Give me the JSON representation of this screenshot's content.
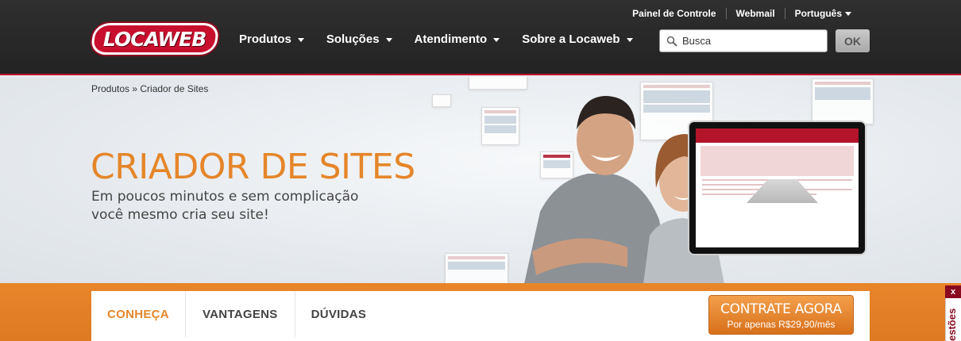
{
  "header": {
    "logo_text": "LOCAWEB",
    "util_links": [
      "Painel de Controle",
      "Webmail",
      "Português"
    ],
    "nav": [
      "Produtos",
      "Soluções",
      "Atendimento",
      "Sobre a Locaweb"
    ],
    "search": {
      "placeholder": "Busca",
      "button": "OK"
    }
  },
  "hero": {
    "breadcrumb": "Produtos » Criador de Sites",
    "title": "CRIADOR DE SITES",
    "subtitle_line1": "Em poucos minutos e sem complicação",
    "subtitle_line2": "você mesmo cria seu site!"
  },
  "tabs": {
    "items": [
      "CONHEÇA",
      "VANTAGENS",
      "DÚVIDAS"
    ],
    "active": "CONHEÇA"
  },
  "cta": {
    "title": "CONTRATE AGORA",
    "subtitle": "Por apenas R$29,90/mês"
  },
  "side_tab": {
    "close": "x",
    "label": "estões"
  },
  "colors": {
    "accent": "#e5862a",
    "brand_red": "#c8102e",
    "header_bg": "#2a2a2a"
  }
}
